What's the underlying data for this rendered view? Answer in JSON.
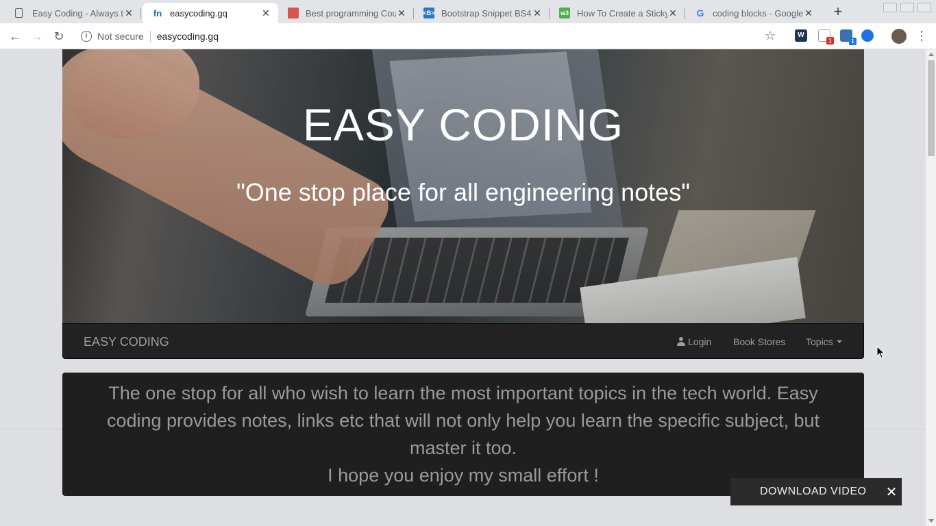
{
  "browser": {
    "tabs": [
      {
        "title": "Easy Coding - Always th",
        "favicon": "page-icon",
        "active": false
      },
      {
        "title": "easycoding.gq",
        "favicon": "fn",
        "active": true
      },
      {
        "title": "Best programming Cou",
        "favicon": "book-icon",
        "active": false
      },
      {
        "title": "Bootstrap Snippet BS4",
        "favicon": "<B>",
        "active": false
      },
      {
        "title": "How To Create a Sticky",
        "favicon": "w3",
        "active": false
      },
      {
        "title": "coding blocks - Google",
        "favicon": "google-icon",
        "active": false
      }
    ],
    "new_tab": "+",
    "security": "Not secure",
    "url": "easycoding.gq",
    "extensions": [
      {
        "name": "w-extension-icon",
        "glyph": "W"
      },
      {
        "name": "shield-extension-icon",
        "badge": "1"
      },
      {
        "name": "bag-extension-icon",
        "badge": "1"
      },
      {
        "name": "camera-extension-icon"
      }
    ]
  },
  "hero": {
    "title": "EASY CODING",
    "tagline": "\"One stop place for all engineering notes\""
  },
  "navbar": {
    "brand": "EASY CODING",
    "login": "Login",
    "book_stores": "Book Stores",
    "topics": "Topics"
  },
  "intro": {
    "text": "The one stop for all who wish to learn the most important topics in the tech world. Easy coding provides notes, links etc that will not only help you learn the specific subject, but master it too.",
    "closing": "I hope you enjoy my small effort !"
  },
  "download": {
    "label": "DOWNLOAD VIDEO",
    "close": "✕"
  },
  "colors": {
    "navbar_bg": "#222222",
    "navbar_text": "#9d9d9d",
    "intro_bg": "#1f1f1f",
    "intro_text": "#9a9a9a",
    "page_bg": "#dedfe2"
  }
}
